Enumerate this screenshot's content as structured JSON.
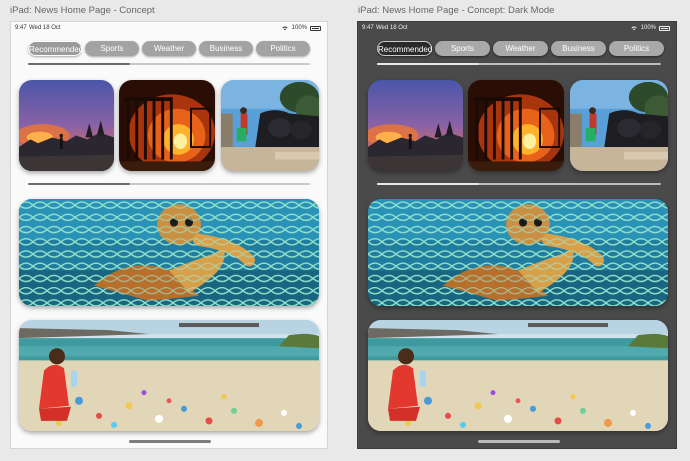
{
  "panels": [
    {
      "title": "iPad: News Home Page - Concept",
      "status": {
        "time": "9:47",
        "date": "Wed 18 Oct",
        "battery": "100%"
      },
      "tabs": [
        "Recommended",
        "Sports",
        "Weather",
        "Business",
        "Politics"
      ],
      "active_tab": "Recommended"
    },
    {
      "title": "iPad: News Home Page - Concept: Dark Mode",
      "status": {
        "time": "9:47",
        "date": "Wed 18 Oct",
        "battery": "100%"
      },
      "tabs": [
        "Recommended",
        "Sports",
        "Weather",
        "Business",
        "Politics"
      ],
      "active_tab": "Recommended"
    }
  ],
  "cards": [
    {
      "subject": "wildfire-village-photo"
    },
    {
      "subject": "burning-building-photo"
    },
    {
      "subject": "garbage-street-photo"
    },
    {
      "subject": "turtle-in-fishing-net-photo"
    },
    {
      "subject": "plastic-pollution-beach-photo"
    }
  ],
  "colors": {
    "light_bg": "#fafafa",
    "dark_bg": "#4a4a4a",
    "tab_gray": "#a3a3a3",
    "active_tab_dark": "#2a2a2a"
  }
}
